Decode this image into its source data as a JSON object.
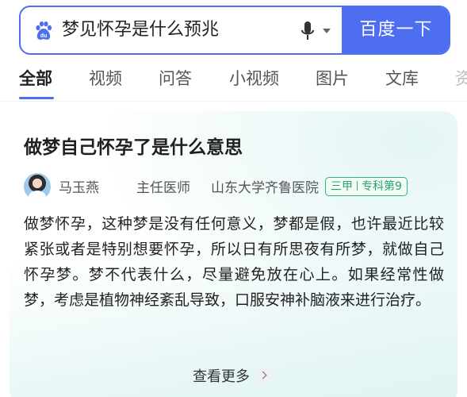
{
  "search": {
    "query": "梦见怀孕是什么预兆",
    "button_label": "百度一下",
    "logo_icon": "baidu-paw-icon",
    "mic_icon": "microphone-icon",
    "accent": "#4e6ef2"
  },
  "tabs": [
    {
      "label": "全部",
      "active": true
    },
    {
      "label": "视频",
      "active": false
    },
    {
      "label": "问答",
      "active": false
    },
    {
      "label": "小视频",
      "active": false
    },
    {
      "label": "图片",
      "active": false
    },
    {
      "label": "文库",
      "active": false
    },
    {
      "label": "资",
      "active": false
    }
  ],
  "card": {
    "title": "做梦自己怀孕了是什么意思",
    "author": {
      "name": "马玉燕",
      "title": "主任医师",
      "hospital": "山东大学齐鲁医院",
      "badge_level": "三甲",
      "badge_specialty": "专科第9",
      "badge_color": "#2aa36f"
    },
    "body": "做梦怀孕，这种梦是没有任何意义，梦都是假，也许最近比较紧张或者是特别想要怀孕，所以日有所思夜有所梦，就做自己怀孕梦。梦不代表什么，尽量避免放在心上。如果经常性做梦，考虑是植物神经紊乱导致，口服安神补脑液来进行治疗。",
    "more_label": "查看更多"
  }
}
